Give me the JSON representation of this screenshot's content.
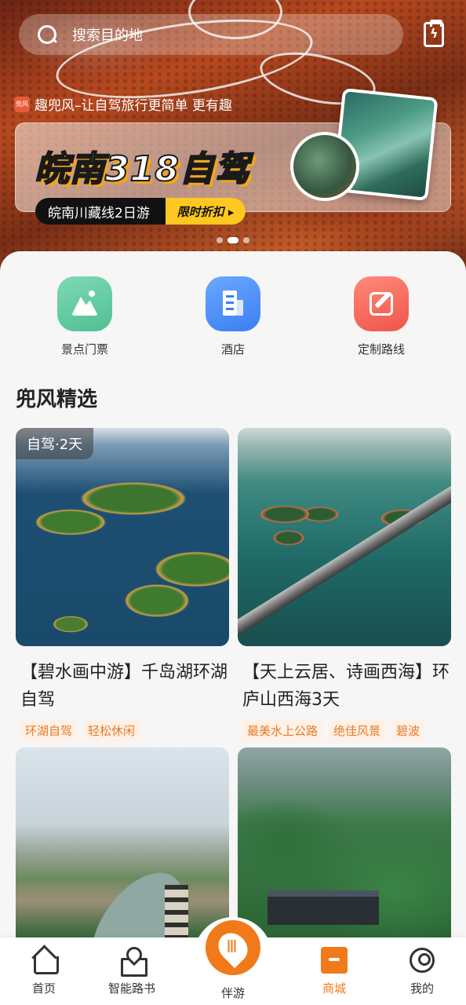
{
  "search": {
    "placeholder": "搜索目的地"
  },
  "slogan": {
    "logo_text": "兜风",
    "text": "趣兜风–让自驾旅行更简单 更有趣"
  },
  "banner": {
    "headline": "皖南318自驾",
    "subtitle": "皖南川藏线2日游",
    "promo_tag": "限时折扣 ▸",
    "carousel_index": 2,
    "carousel_count": 3
  },
  "quick_actions": [
    {
      "label": "景点门票",
      "icon": "landscape-icon",
      "color": "#5fcb9f"
    },
    {
      "label": "酒店",
      "icon": "building-icon",
      "color": "#4a8cf7"
    },
    {
      "label": "定制路线",
      "icon": "edit-icon",
      "color": "#f2665a"
    }
  ],
  "section": {
    "title": "兜风精选"
  },
  "cards": [
    {
      "badge": "自驾·2天",
      "title": "【碧水画中游】千岛湖环湖自驾",
      "tags": [
        "环湖自驾",
        "轻松休闲"
      ]
    },
    {
      "badge": "",
      "title": "【天上云居、诗画西海】环庐山西海3天",
      "tags": [
        "最美水上公路",
        "绝佳风景",
        "碧波"
      ]
    },
    {
      "badge": "",
      "title": "",
      "tags": []
    },
    {
      "badge": "",
      "title": "",
      "tags": []
    }
  ],
  "nav": {
    "items": [
      {
        "label": "首页",
        "icon": "home-icon"
      },
      {
        "label": "智能路书",
        "icon": "map-pin-icon"
      },
      {
        "label": "伴游",
        "icon": "voice-pin-icon"
      },
      {
        "label": "商城",
        "icon": "shop-icon",
        "active": true
      },
      {
        "label": "我的",
        "icon": "user-icon"
      }
    ]
  },
  "colors": {
    "accent": "#f07a1a",
    "tag_bg": "#fff1e5",
    "tag_text": "#e57b2a"
  }
}
